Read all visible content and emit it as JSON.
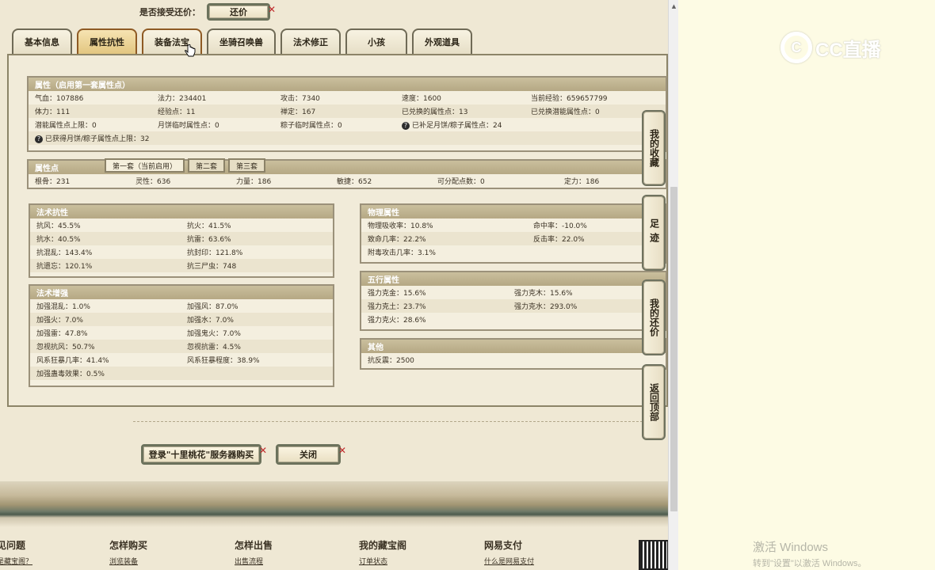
{
  "accept_bargain": {
    "label": "是否接受还价：",
    "button": "还价"
  },
  "tabs": [
    {
      "label": "基本信息"
    },
    {
      "label": "属性抗性"
    },
    {
      "label": "装备法宝"
    },
    {
      "label": "坐骑召唤兽"
    },
    {
      "label": "法术修正"
    },
    {
      "label": "小孩"
    },
    {
      "label": "外观道具"
    }
  ],
  "attributes": {
    "header": "属性（启用第一套属性点）",
    "rows": [
      [
        "气血：107886",
        "法力：234401",
        "攻击：7340",
        "速度：1600",
        "当前经验：659657799"
      ],
      [
        "体力：111",
        "经验点：11",
        "禅定：167",
        "已兑换的属性点：13",
        "已兑换潜能属性点：0"
      ],
      [
        "潜能属性点上限：0",
        "月饼临时属性点：0",
        "粽子临时属性点：0",
        "已补足月饼/粽子属性点：24",
        ""
      ],
      [
        "已获得月饼/粽子属性点上限：32"
      ]
    ]
  },
  "points": {
    "header": "属性点",
    "tabs": [
      "第一套（当前启用）",
      "第二套",
      "第三套"
    ],
    "row": [
      "根骨：231",
      "灵性：636",
      "力量：186",
      "敏捷：652",
      "可分配点数：0",
      "定力：186"
    ]
  },
  "spell_resist": {
    "header": "法术抗性",
    "rows": [
      [
        "抗风：45.5%",
        "抗火：41.5%"
      ],
      [
        "抗水：40.5%",
        "抗雷：63.6%"
      ],
      [
        "抗混乱：143.4%",
        "抗封印：121.8%"
      ],
      [
        "抗遗忘：120.1%",
        "抗三尸虫：748"
      ]
    ]
  },
  "spell_boost": {
    "header": "法术增强",
    "rows": [
      [
        "加强混乱：1.0%",
        "加强风：87.0%"
      ],
      [
        "加强火：7.0%",
        "加强水：7.0%"
      ],
      [
        "加强雷：47.8%",
        "加强鬼火：7.0%"
      ],
      [
        "忽视抗风：50.7%",
        "忽视抗雷：4.5%"
      ],
      [
        "风系狂暴几率：41.4%",
        "风系狂暴程度：38.9%"
      ],
      [
        "加强蛊毒效果：0.5%",
        ""
      ]
    ]
  },
  "physical": {
    "header": "物理属性",
    "rows": [
      [
        "物理吸收率：10.8%",
        "命中率：-10.0%"
      ],
      [
        "致命几率：22.2%",
        "反击率：22.0%"
      ],
      [
        "附毒攻击几率：3.1%",
        ""
      ]
    ]
  },
  "elements": {
    "header": "五行属性",
    "rows": [
      [
        "强力克金：15.6%",
        "强力克木：15.6%"
      ],
      [
        "强力克土：23.7%",
        "强力克水：293.0%"
      ],
      [
        "强力克火：28.6%",
        ""
      ]
    ]
  },
  "other": {
    "header": "其他",
    "rows": [
      [
        "抗反震：2500"
      ]
    ]
  },
  "buttons": {
    "login": "登录\"十里桃花\"服务器购买",
    "close": "关闭"
  },
  "side_buttons": [
    {
      "label": "我的收藏"
    },
    {
      "label": "足迹"
    },
    {
      "label": "我的还价"
    },
    {
      "label": "返回顶部"
    }
  ],
  "footer_nav": [
    {
      "title": "见问题",
      "link": "是藏宝阁？"
    },
    {
      "title": "怎样购买",
      "link": "浏览装备"
    },
    {
      "title": "怎样出售",
      "link": "出售流程"
    },
    {
      "title": "我的藏宝阁",
      "link": "订单状态"
    },
    {
      "title": "网易支付",
      "link": "什么是网易支付"
    }
  ],
  "logo": {
    "mark": "C",
    "text": "CC直播"
  },
  "watermark": {
    "line1": "激活 Windows",
    "line2": "转到\"设置\"以激活 Windows。"
  }
}
